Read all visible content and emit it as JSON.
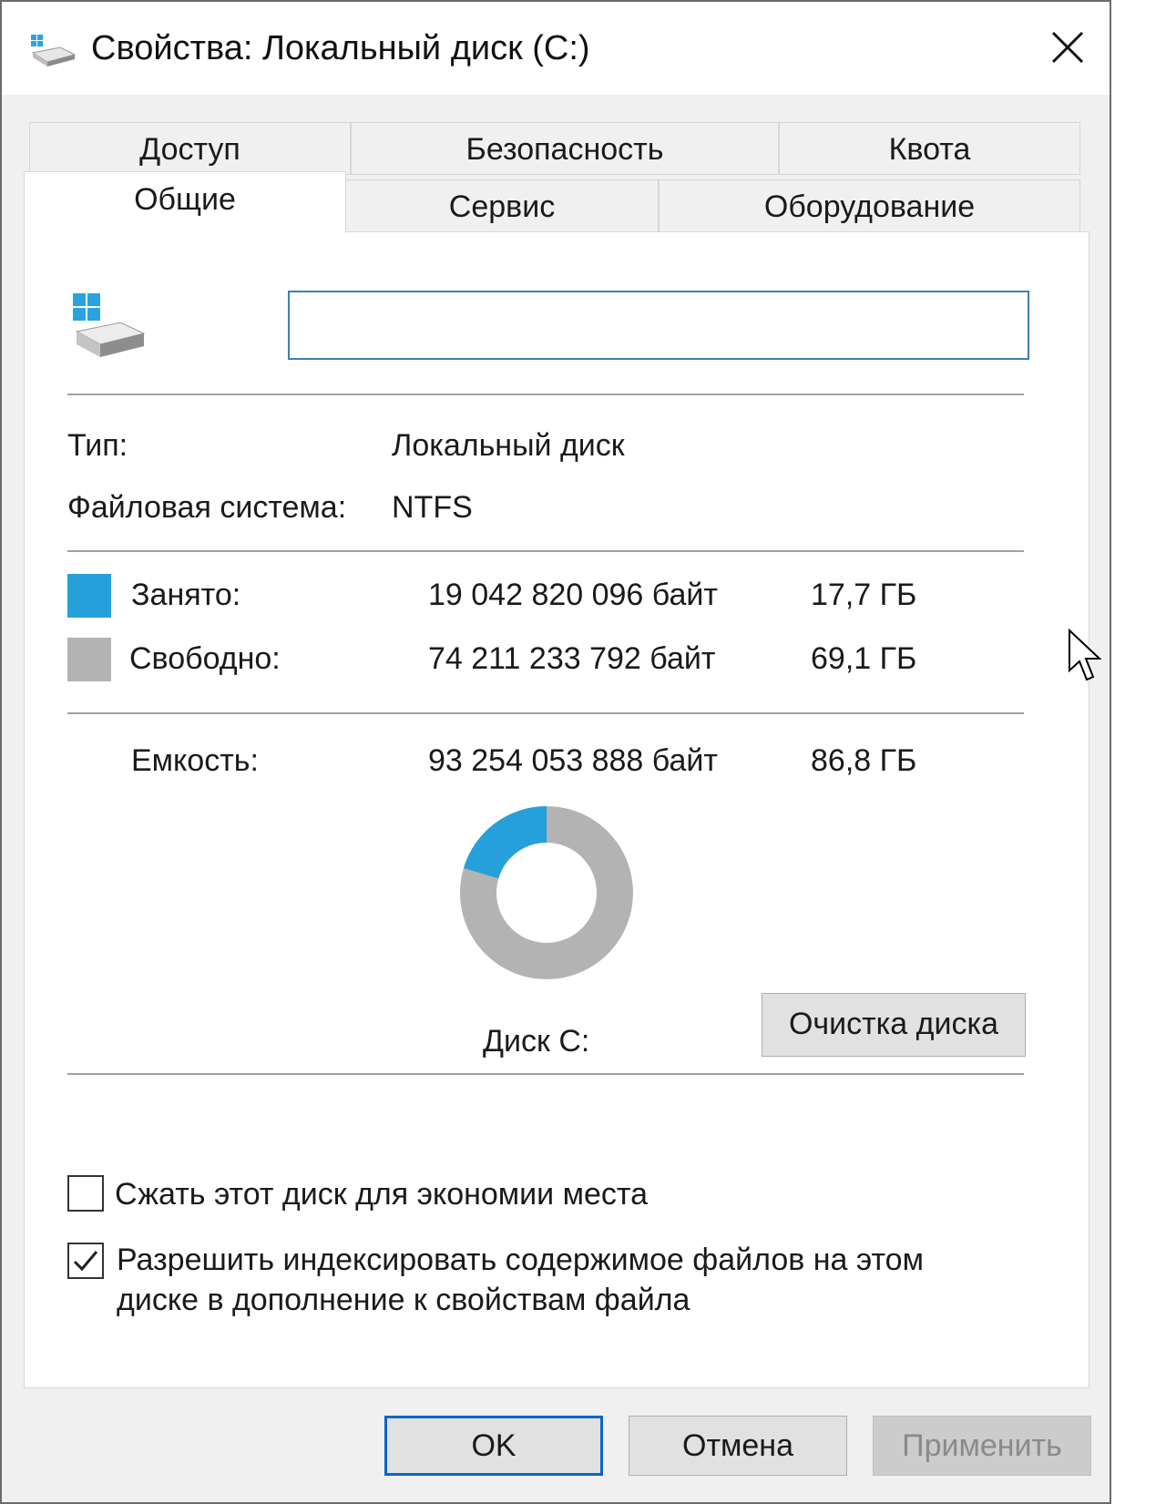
{
  "window": {
    "title": "Свойства: Локальный диск (C:)",
    "close_icon": "close-icon",
    "app_icon": "drive-icon"
  },
  "tabs_top": [
    {
      "label": "Доступ"
    },
    {
      "label": "Безопасность"
    },
    {
      "label": "Квота"
    }
  ],
  "tabs_bottom": [
    {
      "label": "Общие",
      "active": true
    },
    {
      "label": "Сервис"
    },
    {
      "label": "Оборудование"
    }
  ],
  "general": {
    "drive_icon": "windows-drive-icon",
    "name_value": "",
    "type_label": "Тип:",
    "type_value": "Локальный диск",
    "fs_label": "Файловая система:",
    "fs_value": "NTFS",
    "used_label": "Занято:",
    "used_bytes": "19 042 820 096 байт",
    "used_gb": "17,7 ГБ",
    "free_label": "Свободно:",
    "free_bytes": "74 211 233 792 байт",
    "free_gb": "69,1 ГБ",
    "capacity_label": "Емкость:",
    "capacity_bytes": "93 254 053 888 байт",
    "capacity_gb": "86,8 ГБ",
    "disk_label": "Диск C:",
    "cleanup_button": "Очистка диска",
    "used_color": "#26a0da",
    "free_color": "#b3b3b3",
    "used_fraction": 0.204
  },
  "options": {
    "compress_label": "Сжать этот диск для экономии места",
    "compress_checked": false,
    "index_label_line1": "Разрешить индексировать содержимое файлов на этом",
    "index_label_line2": "диске в дополнение к свойствам файла",
    "index_checked": true
  },
  "buttons": {
    "ok": "OK",
    "cancel": "Отмена",
    "apply": "Применить"
  }
}
